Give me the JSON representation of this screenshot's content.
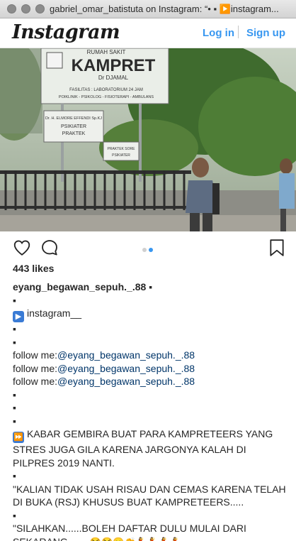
{
  "window": {
    "title": "gabriel_omar_batistuta on Instagram: “• ▪ ▶️instagram..."
  },
  "header": {
    "logo_text": "Instagram",
    "login_label": "Log in",
    "signup_label": "Sign up",
    "accent_color": "#3897f0"
  },
  "photo": {
    "sign_main_top": "RUMAH SAKIT",
    "sign_main": "KAMPRET",
    "sign_main_doctor": "Dr DJAMAL",
    "sign_main_line1": "FASILITAS : LABORATORIUM 24 JAM",
    "sign_main_line2": "POIKLINIK - PSIKOLOG - FISIOTERAPI - AMBULANS",
    "sign_left_title": "Dr. H. ELMORE EFFENDI Sp.KJ",
    "sign_left_sub1": "PSIKIATER",
    "sign_left_sub2": "PRAKTEK",
    "sign_right_title": "PRAKTEK SORE",
    "sign_right_sub": "PSIKIATER",
    "carousel_total": 2,
    "carousel_active": 2
  },
  "post": {
    "likes": "443 likes",
    "caption": {
      "username": "eyang_begawan_sepuh._.88",
      "head_tail": " ▪",
      "l1": "▪",
      "l2_icon": "▶",
      "l2_text": "instagram__",
      "l3": "▪",
      "l4": "▪",
      "follow_prefix": "follow me:",
      "follow_handle": "@eyang_begawan_sepuh._.88",
      "l8": "▪",
      "l9": "▪",
      "l10": "▪",
      "news_icon": "⏩",
      "news_text": "KABAR GEMBIRA BUAT PARA KAMPRETEERS YANG STRES JUGA GILA KARENA JARGONYA KALAH DI PILPRES 2019 NANTI.",
      "l12": "▪",
      "quote1": "\"KALIAN TIDAK USAH RISAU DAN CEMAS KARENA TELAH DI BUKA (RSJ) KHUSUS BUAT KAMPRETEERS.....",
      "l14": "▪",
      "quote2": "\"SILAHKAN......BOLEH DAFTAR DULU MULAI DARI SEKARANG........",
      "quote2_emojis": "😂😂😛👏💃💃💃💃"
    }
  }
}
